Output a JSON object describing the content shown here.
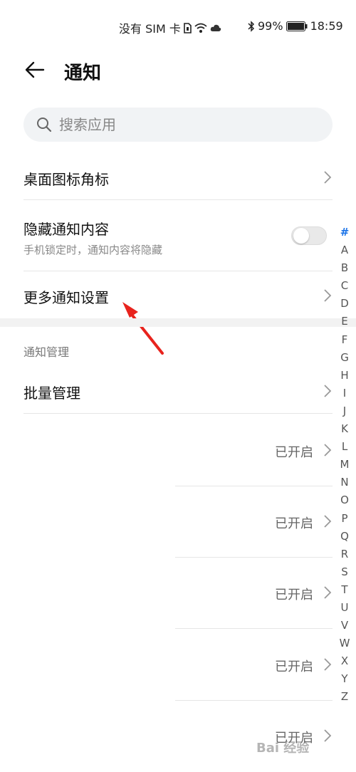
{
  "status_bar": {
    "carrier": "没有 SIM 卡",
    "battery": "99%",
    "time": "18:59"
  },
  "header": {
    "title": "通知"
  },
  "search": {
    "placeholder": "搜索应用"
  },
  "settings": {
    "badge_label": "桌面图标角标",
    "hide_label": "隐藏通知内容",
    "hide_sub": "手机锁定时，通知内容将隐藏",
    "hide_enabled": false,
    "more_label": "更多通知设置"
  },
  "management": {
    "section_title": "通知管理",
    "batch_label": "批量管理",
    "apps": [
      {
        "status": "已开启"
      },
      {
        "status": "已开启"
      },
      {
        "status": "已开启"
      },
      {
        "status": "已开启"
      },
      {
        "status": "已开启"
      }
    ]
  },
  "alpha_index": [
    "#",
    "A",
    "B",
    "C",
    "D",
    "E",
    "F",
    "G",
    "H",
    "I",
    "J",
    "K",
    "L",
    "M",
    "N",
    "O",
    "P",
    "Q",
    "R",
    "S",
    "T",
    "U",
    "V",
    "W",
    "X",
    "Y",
    "Z"
  ],
  "watermark": "Bai 经验",
  "colors": {
    "accent": "#1a73e8",
    "annotation": "#e8231d"
  }
}
